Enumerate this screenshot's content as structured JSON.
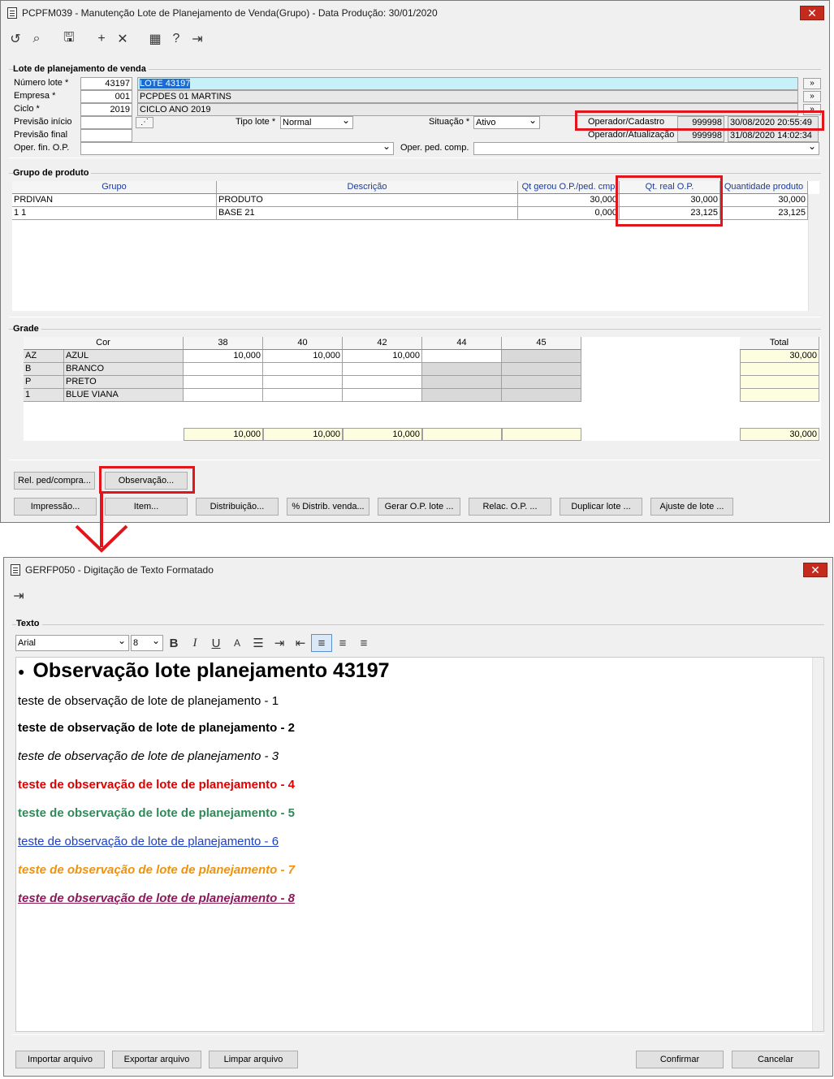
{
  "win1": {
    "title": "PCPFM039 - Manutenção Lote de Planejamento de Venda(Grupo) - Data Produção: 30/01/2020",
    "lote": {
      "legend": "Lote de planejamento de venda",
      "numero_label": "Número lote *",
      "numero": "43197",
      "numero_desc": "LOTE 43197",
      "empresa_label": "Empresa *",
      "empresa": "001",
      "empresa_desc": "PCPDES 01 MARTINS",
      "ciclo_label": "Ciclo *",
      "ciclo": "2019",
      "ciclo_desc": "CICLO ANO 2019",
      "prev_inicio_label": "Previsão início",
      "prev_final_label": "Previsão final",
      "tipo_label": "Tipo lote *",
      "tipo": "Normal",
      "situacao_label": "Situação *",
      "situacao": "Ativo",
      "op_cad_label": "Operador/Cadastro",
      "op_cad_code": "999998",
      "op_cad_date": "30/08/2020 20:55:49",
      "op_atu_label": "Operador/Atualização",
      "op_atu_code": "999998",
      "op_atu_date": "31/08/2020 14:02:34",
      "oper_fin_label": "Oper. fin. O.P.",
      "oper_ped_label": "Oper. ped. comp.",
      "more": "»"
    },
    "grupo": {
      "legend": "Grupo de produto",
      "headers": [
        "Grupo",
        "Descrição",
        "Qt gerou O.P./ped. cmp",
        "Qt. real O.P.",
        "Quantidade produto"
      ],
      "rows": [
        [
          "PRDIVAN",
          "PRODUTO",
          "30,000",
          "30,000",
          "30,000"
        ],
        [
          "1 1",
          "BASE 21",
          "0,000",
          "23,125",
          "23,125"
        ]
      ]
    },
    "grade": {
      "legend": "Grade",
      "headers": [
        "Cor",
        "38",
        "40",
        "42",
        "44",
        "45",
        "Total"
      ],
      "rows": [
        [
          "AZ",
          "AZUL",
          "10,000",
          "10,000",
          "10,000",
          "",
          "",
          "30,000"
        ],
        [
          "B",
          "BRANCO",
          "",
          "",
          "",
          "",
          "",
          ""
        ],
        [
          "P",
          "PRETO",
          "",
          "",
          "",
          "",
          "",
          ""
        ],
        [
          "1",
          "BLUE VIANA",
          "",
          "",
          "",
          "",
          "",
          ""
        ]
      ],
      "totals": [
        "10,000",
        "10,000",
        "10,000",
        "",
        "",
        "30,000"
      ]
    },
    "buttons": {
      "rel": "Rel. ped/compra...",
      "obs": "Observação...",
      "impressao": "Impressão...",
      "item": "Item...",
      "distribuicao": "Distribuição...",
      "distrib_venda": "% Distrib. venda...",
      "gerar": "Gerar O.P. lote ...",
      "relac": "Relac. O.P. ...",
      "duplicar": "Duplicar lote ...",
      "ajuste": "Ajuste de lote ..."
    }
  },
  "win2": {
    "title": "GERFP050 - Digitação de Texto Formatado",
    "legend": "Texto",
    "font": "Arial",
    "size": "8",
    "heading": "Observação lote planejamento 43197",
    "lines": [
      "teste de observação de lote de planejamento - 1",
      "teste de observação de lote de planejamento - 2",
      "teste de observação de lote de planejamento - 3",
      "teste de observação de lote de planejamento - 4",
      "teste de observação de lote de planejamento - 5",
      "teste de observação de lote de planejamento - 6",
      "teste de observação de lote de planejamento - 7",
      "teste de observação de lote de planejamento - 8"
    ],
    "colors": {
      "red": "#e00000",
      "green": "#2e8b57",
      "blue": "#1c3fc4",
      "orange": "#f0920a",
      "purple": "#8b1a5a"
    },
    "buttons": {
      "importar": "Importar arquivo",
      "exportar": "Exportar arquivo",
      "limpar": "Limpar arquivo",
      "confirmar": "Confirmar",
      "cancelar": "Cancelar"
    }
  }
}
